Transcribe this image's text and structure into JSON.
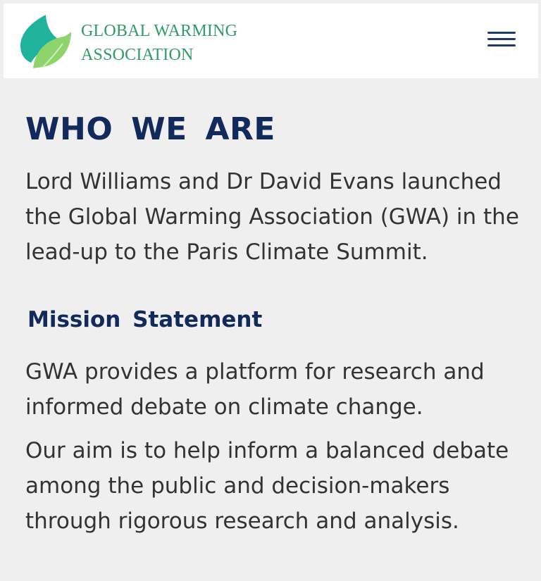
{
  "header": {
    "logo_line1": "GLOBAL WARMING",
    "logo_line2": "ASSOCIATION",
    "logo_icon": "leaf-icon",
    "menu_icon": "hamburger-menu-icon"
  },
  "main": {
    "title": "WHO  WE  ARE",
    "intro": "Lord Williams and Dr David Evans launched the Global Warming Association (GWA) in the lead-up to the Paris Climate Summit.",
    "section_title": "Mission  Statement",
    "paragraph1": "GWA provides a platform for research and informed debate on climate change.",
    "paragraph2": "Our aim is to help inform a balanced debate among the public and decision-makers through rigorous research and analysis."
  },
  "colors": {
    "brand_green": "#2f9c67",
    "navy": "#12295c",
    "text": "#333333",
    "background": "#efefef"
  }
}
